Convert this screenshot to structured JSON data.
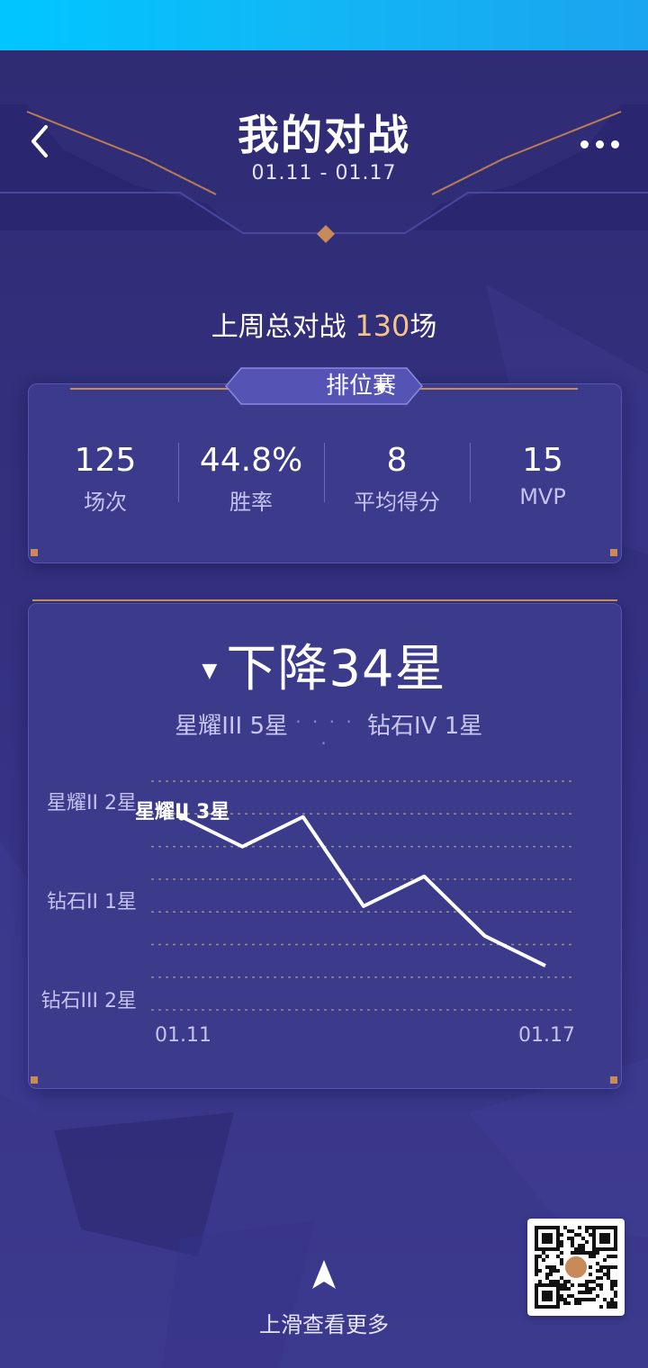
{
  "header": {
    "title": "我的对战",
    "date_range": "01.11 - 01.17"
  },
  "summary": {
    "prefix": "上周总对战 ",
    "count": "130",
    "suffix": "场"
  },
  "mode_selector": {
    "label": "排位赛",
    "caret": "▼"
  },
  "stats": [
    {
      "value": "125",
      "label": "场次"
    },
    {
      "value": "44.8%",
      "label": "胜率"
    },
    {
      "value": "8",
      "label": "平均得分"
    },
    {
      "value": "15",
      "label": "MVP"
    }
  ],
  "rank": {
    "arrow": "▼",
    "change": "下降34星",
    "from": "星耀III 5星",
    "dots": "· · · · ·",
    "to": "钻石IV 1星"
  },
  "chart_data": {
    "type": "line",
    "x": [
      "01.11",
      "01.12",
      "01.13",
      "01.14",
      "01.15",
      "01.16",
      "01.17"
    ],
    "x_tick_labels": [
      "01.11",
      "01.17"
    ],
    "y_tick_labels": [
      "星耀II 2星",
      "钻石II 1星",
      "钻石III 2星"
    ],
    "series": [
      {
        "values": [
          6,
          5,
          6,
          3,
          4,
          2,
          1
        ]
      }
    ],
    "ylim": [
      -0.6,
      7.5
    ],
    "point_annotation": "星耀II 3星",
    "grid": true,
    "colors": {
      "line": "#ffffff",
      "grid": "#b9a98a"
    }
  },
  "footer": {
    "swipe_text": "上滑查看更多"
  },
  "icons": {
    "back": "chevron-left-icon",
    "more": "more-dots-icon",
    "swipe": "arrow-up-icon",
    "qr": "qr-code"
  },
  "colors": {
    "background": "#322f7a",
    "card": "#3b3a8b",
    "accent": "#f7c487",
    "status_bar": "#12b6f5"
  }
}
